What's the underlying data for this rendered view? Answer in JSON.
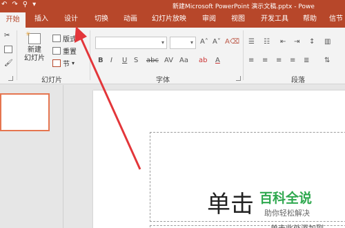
{
  "titlebar": {
    "title": "新建Microsoft PowerPoint 演示文稿.pptx - Powe",
    "qat": [
      "↶",
      "↷",
      "⚲",
      "▾"
    ]
  },
  "tabs": [
    {
      "label": "开始",
      "active": true
    },
    {
      "label": "插入"
    },
    {
      "label": "设计"
    },
    {
      "label": "切换"
    },
    {
      "label": "动画"
    },
    {
      "label": "幻灯片放映"
    },
    {
      "label": "审阅"
    },
    {
      "label": "视图"
    },
    {
      "label": "开发工具"
    },
    {
      "label": "帮助"
    },
    {
      "label": "信节"
    }
  ],
  "ribbon": {
    "slides_group": {
      "new_slide_l1": "新建",
      "new_slide_l2": "幻灯片",
      "layout": "版式",
      "reset": "重置",
      "section": "节",
      "label": "幻灯片"
    },
    "font_group": {
      "label": "字体"
    },
    "paragraph_group": {
      "label": "段落"
    }
  },
  "slide": {
    "title_text": "单击",
    "subtitle_fragment": "单击此处添加副"
  },
  "watermark": {
    "main": "百科全说",
    "sub": "助你轻松解决"
  },
  "colors": {
    "accent": "#b7472a",
    "thumb_border": "#e5754f",
    "annotation_arrow": "#e3363a",
    "watermark_green": "#2fa84f"
  }
}
